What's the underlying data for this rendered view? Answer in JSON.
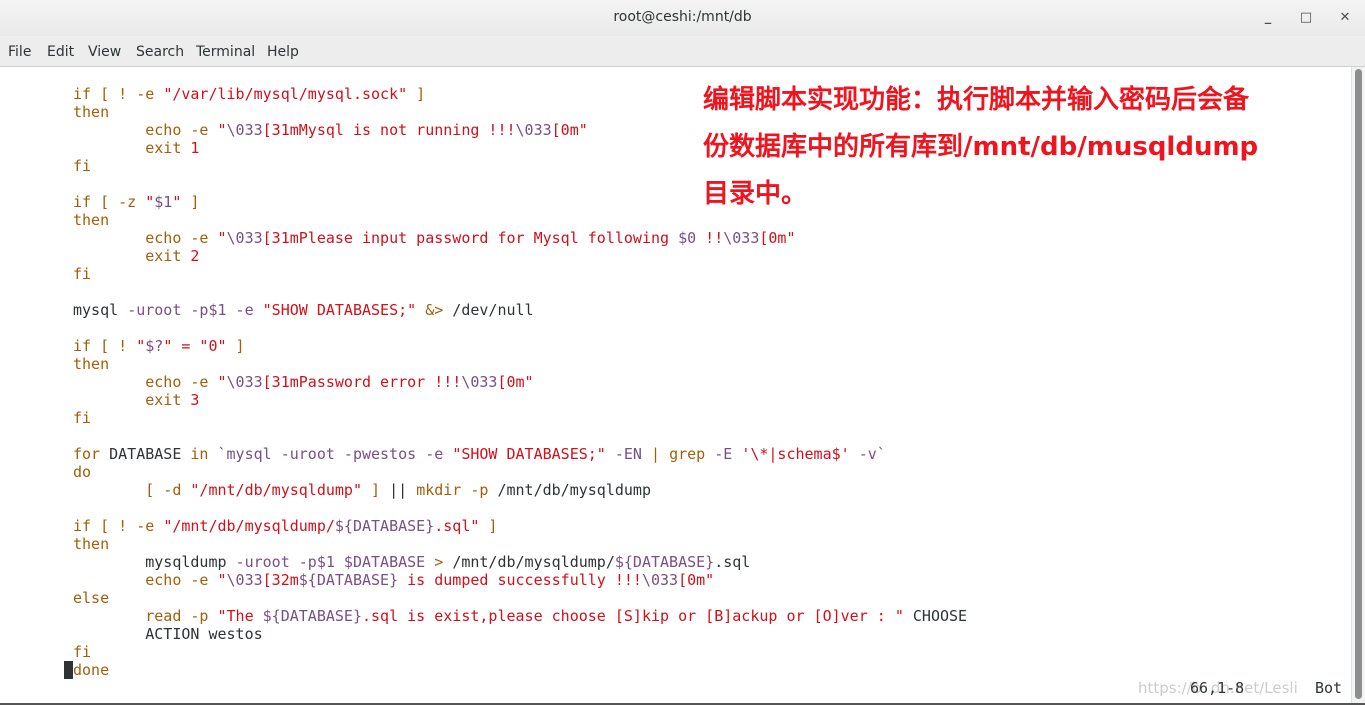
{
  "window": {
    "title": "root@ceshi:/mnt/db",
    "minimize": "_",
    "maximize": "□",
    "close": "✕"
  },
  "menu": [
    "File",
    "Edit",
    "View",
    "Search",
    "Terminal",
    "Help"
  ],
  "annotation": [
    "编辑脚本实现功能：执行脚本并输入密码后会备",
    "份数据库中的所有库到/mnt/db/musqldump",
    "目录中。"
  ],
  "colors": {
    "keyword": "#a35e0a",
    "string": "#d1101a",
    "variable": "#7a4f86",
    "text": "#2e3436",
    "annotation": "#f0141e"
  },
  "code": [
    [
      [
        "if [ ! -e ",
        "k"
      ],
      [
        "\"/var/lib/mysql/mysql.sock\"",
        "s"
      ],
      [
        " ]",
        "k"
      ]
    ],
    [
      [
        "then",
        "k"
      ]
    ],
    [
      [
        "        echo -e ",
        "k"
      ],
      [
        "\"",
        "s"
      ],
      [
        "\\033",
        "v"
      ],
      [
        "[31mMysql is not running !!!",
        "s"
      ],
      [
        "\\033",
        "v"
      ],
      [
        "[0m\"",
        "s"
      ]
    ],
    [
      [
        "        exit ",
        "k"
      ],
      [
        "1",
        "s"
      ]
    ],
    [
      [
        "fi",
        "k"
      ]
    ],
    [],
    [
      [
        "if [ -z ",
        "k"
      ],
      [
        "\"",
        "s"
      ],
      [
        "$1",
        "v"
      ],
      [
        "\"",
        "s"
      ],
      [
        " ]",
        "k"
      ]
    ],
    [
      [
        "then",
        "k"
      ]
    ],
    [
      [
        "        echo -e ",
        "k"
      ],
      [
        "\"",
        "s"
      ],
      [
        "\\033",
        "v"
      ],
      [
        "[31mPlease input password for Mysql following ",
        "s"
      ],
      [
        "$0",
        "v"
      ],
      [
        " !!",
        "s"
      ],
      [
        "\\033",
        "v"
      ],
      [
        "[0m\"",
        "s"
      ]
    ],
    [
      [
        "        exit ",
        "k"
      ],
      [
        "2",
        "s"
      ]
    ],
    [
      [
        "fi",
        "k"
      ]
    ],
    [],
    [
      [
        "mysql ",
        "n"
      ],
      [
        "-uroot -p$1 -e ",
        "v"
      ],
      [
        "\"SHOW DATABASES;\"",
        "s"
      ],
      [
        " &>",
        "k"
      ],
      [
        " /dev/null",
        "n"
      ]
    ],
    [],
    [
      [
        "if [ ! ",
        "k"
      ],
      [
        "\"",
        "s"
      ],
      [
        "$?",
        "v"
      ],
      [
        "\" = \"0\"",
        "s"
      ],
      [
        " ]",
        "k"
      ]
    ],
    [
      [
        "then",
        "k"
      ]
    ],
    [
      [
        "        echo -e ",
        "k"
      ],
      [
        "\"",
        "s"
      ],
      [
        "\\033",
        "v"
      ],
      [
        "[31mPassword error !!!",
        "s"
      ],
      [
        "\\033",
        "v"
      ],
      [
        "[0m\"",
        "s"
      ]
    ],
    [
      [
        "        exit ",
        "k"
      ],
      [
        "3",
        "s"
      ]
    ],
    [
      [
        "fi",
        "k"
      ]
    ],
    [],
    [
      [
        "for ",
        "k"
      ],
      [
        "DATABASE ",
        "n"
      ],
      [
        "in ",
        "k"
      ],
      [
        "`mysql -uroot -pwestos -e ",
        "v"
      ],
      [
        "\"SHOW DATABASES;\"",
        "s"
      ],
      [
        " -EN ",
        "v"
      ],
      [
        "| ",
        "k"
      ],
      [
        "grep ",
        "k"
      ],
      [
        "-E ",
        "v"
      ],
      [
        "'\\*|schema$'",
        "s"
      ],
      [
        " -v`",
        "v"
      ]
    ],
    [
      [
        "do",
        "k"
      ]
    ],
    [
      [
        "        [ -d ",
        "k"
      ],
      [
        "\"/mnt/db/mysqldump\"",
        "s"
      ],
      [
        " ] ",
        "k"
      ],
      [
        "|| ",
        "n"
      ],
      [
        "mkdir -p ",
        "k"
      ],
      [
        "/mnt/db/mysqldump",
        "n"
      ]
    ],
    [],
    [
      [
        "if [ ! -e ",
        "k"
      ],
      [
        "\"/mnt/db/mysqldump/",
        "s"
      ],
      [
        "${DATABASE}",
        "v"
      ],
      [
        ".sql\"",
        "s"
      ],
      [
        " ]",
        "k"
      ]
    ],
    [
      [
        "then",
        "k"
      ]
    ],
    [
      [
        "        mysqldump ",
        "n"
      ],
      [
        "-uroot -p$1 $DATABASE ",
        "v"
      ],
      [
        "> ",
        "k"
      ],
      [
        "/mnt/db/mysqldump/",
        "n"
      ],
      [
        "${DATABASE}",
        "v"
      ],
      [
        ".sql",
        "n"
      ]
    ],
    [
      [
        "        echo -e ",
        "k"
      ],
      [
        "\"",
        "s"
      ],
      [
        "\\033",
        "v"
      ],
      [
        "[32m",
        "s"
      ],
      [
        "${DATABASE}",
        "v"
      ],
      [
        " is dumped successfully !!!",
        "s"
      ],
      [
        "\\033",
        "v"
      ],
      [
        "[0m\"",
        "s"
      ]
    ],
    [
      [
        "else",
        "k"
      ]
    ],
    [
      [
        "        read -p ",
        "k"
      ],
      [
        "\"The ",
        "s"
      ],
      [
        "${DATABASE}",
        "v"
      ],
      [
        ".sql is exist,please choose [S]kip or [B]ackup or [O]ver : \"",
        "s"
      ],
      [
        " CHOOSE",
        "n"
      ]
    ],
    [
      [
        "        ACTION westos",
        "n"
      ]
    ],
    [
      [
        "fi",
        "k"
      ]
    ],
    [
      [
        "done",
        "k"
      ]
    ]
  ],
  "status": {
    "position": "66,1-8",
    "scroll": "Bot"
  },
  "watermark": "https://b  dn.net/Lesli"
}
